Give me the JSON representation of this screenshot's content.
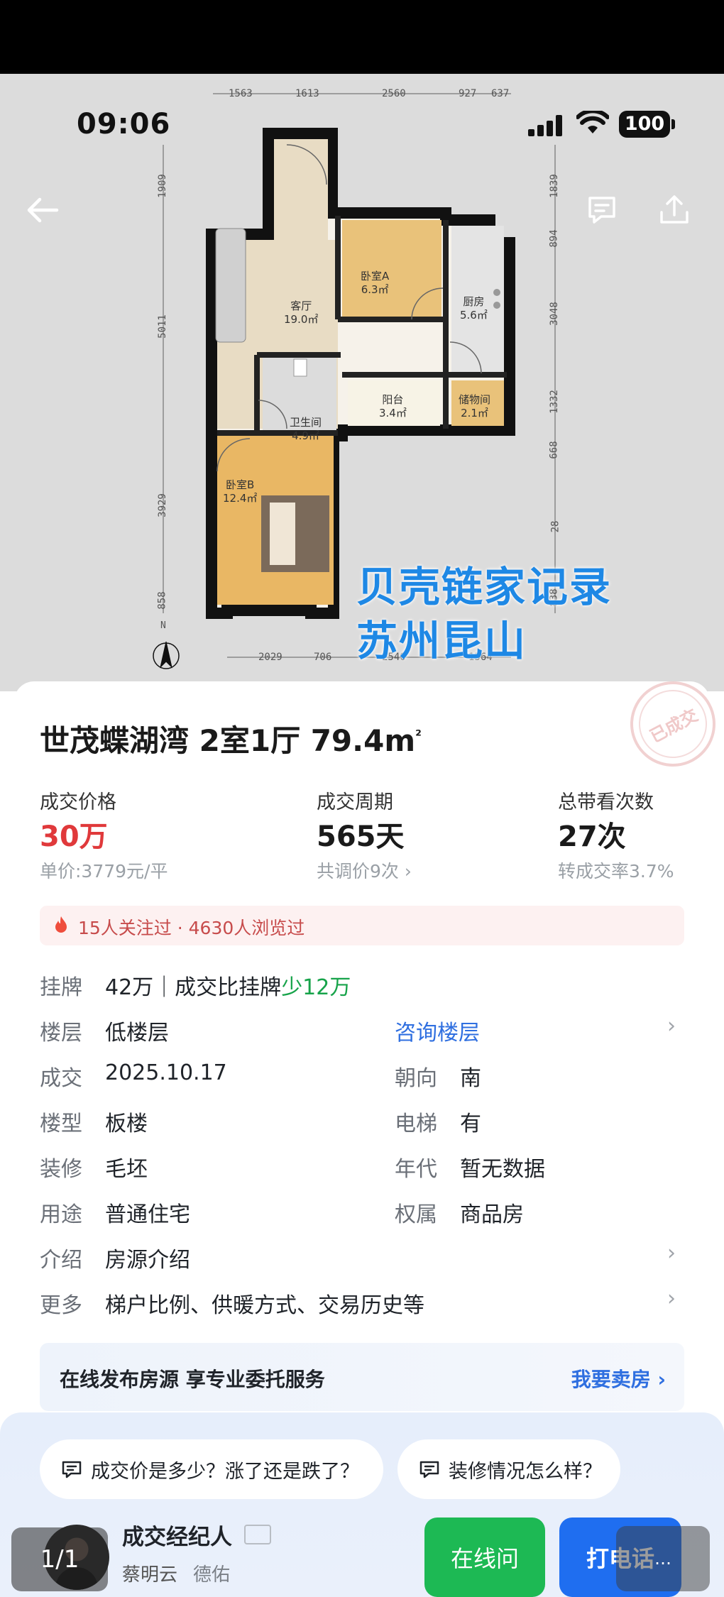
{
  "status": {
    "time": "09:06",
    "battery": "100"
  },
  "floorplan": {
    "rooms": [
      {
        "name": "客厅",
        "area": "19.0㎡"
      },
      {
        "name": "卧室A",
        "area": "6.3㎡"
      },
      {
        "name": "厨房",
        "area": "5.6㎡"
      },
      {
        "name": "阳台",
        "area": "3.4㎡"
      },
      {
        "name": "储物间",
        "area": "2.1㎡"
      },
      {
        "name": "卫生间",
        "area": "4.9㎡"
      },
      {
        "name": "卧室B",
        "area": "12.4㎡"
      }
    ],
    "dims_top": [
      "1563",
      "1613",
      "2560",
      "927",
      "637"
    ],
    "dims_bottom": [
      "2029",
      "706",
      "2540",
      "1564"
    ],
    "dims_left": [
      "1909",
      "5011",
      "3929",
      "858"
    ],
    "dims_right": [
      "1839",
      "894",
      "3048",
      "1332",
      "668",
      "28",
      "838"
    ],
    "compass": "N",
    "watermark_line1": "贝壳链家记录",
    "watermark_line2": "苏州昆山"
  },
  "stamp": "已成交",
  "title": {
    "text": "世茂蝶湖湾 2室1厅 79.4m",
    "sup": "²"
  },
  "stats": [
    {
      "label": "成交价格",
      "value": "30万",
      "sub": "单价:3779元/平"
    },
    {
      "label": "成交周期",
      "value": "565天",
      "sub": "共调价9次 ›"
    },
    {
      "label": "总带看次数",
      "value": "27次",
      "sub": "转成交率3.7%"
    }
  ],
  "attention": "15人关注过 · 4630人浏览过",
  "listing": {
    "label": "挂牌",
    "value": "42万｜成交比挂牌",
    "diff": "少12万"
  },
  "rows": [
    {
      "label": "楼层",
      "value": "低楼层",
      "label2": "",
      "value2": "咨询楼层"
    },
    {
      "label": "成交",
      "value": "2025.10.17",
      "label2": "朝向",
      "value2": "南"
    },
    {
      "label": "楼型",
      "value": "板楼",
      "label2": "电梯",
      "value2": "有"
    },
    {
      "label": "装修",
      "value": "毛坯",
      "label2": "年代",
      "value2": "暂无数据"
    },
    {
      "label": "用途",
      "value": "普通住宅",
      "label2": "权属",
      "value2": "商品房"
    },
    {
      "label": "介绍",
      "value": "房源介绍"
    },
    {
      "label": "更多",
      "value": "梯户比例、供暖方式、交易历史等"
    }
  ],
  "chevron": "›",
  "banner": {
    "left": "在线发布房源 享专业委托服务",
    "right": "我要卖房 ›"
  },
  "chips": [
    "成交价是多少？涨了还是跌了？",
    "装修情况怎么样？"
  ],
  "agent": {
    "title": "成交经纪人",
    "name": "蔡明云",
    "company": "德佑"
  },
  "buttons": {
    "online": "在线问",
    "call": "打电话"
  },
  "page_indicator": "1/1",
  "right_overlay": "…"
}
